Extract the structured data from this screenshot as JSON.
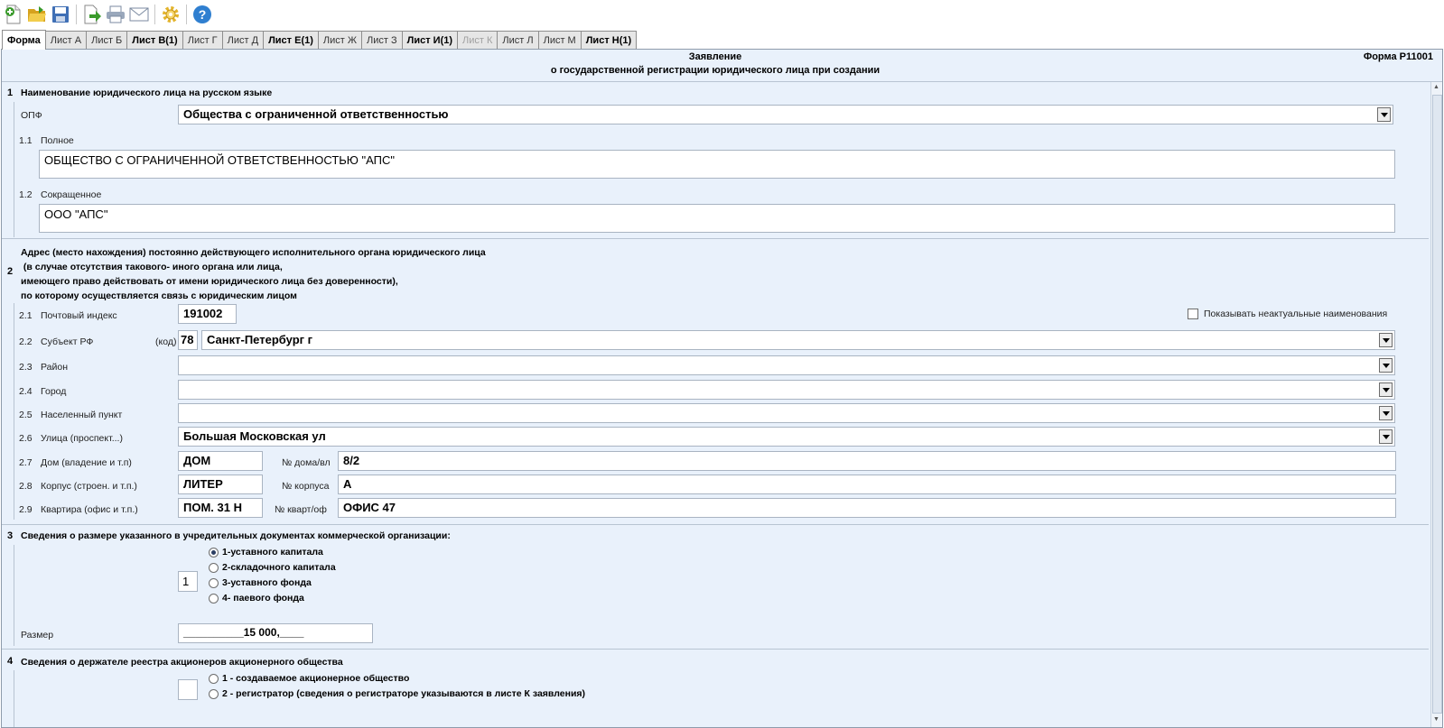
{
  "toolbar": {
    "buttons": [
      {
        "name": "new-document-icon",
        "color": "#3a9a2b"
      },
      {
        "name": "open-folder-icon",
        "color": "#e6b82d"
      },
      {
        "name": "save-disk-icon",
        "color": "#3f6fb5"
      },
      {
        "name": "export-icon",
        "color": "#4b87c7"
      },
      {
        "name": "print-icon",
        "color": "#7b8aa0"
      },
      {
        "name": "email-icon",
        "color": "#7b8aa0"
      },
      {
        "name": "settings-gear-icon",
        "color": "#e3b32a"
      },
      {
        "name": "help-icon",
        "color": "#2f7fd0"
      }
    ]
  },
  "tabs": [
    {
      "label": "Форма",
      "state": "active"
    },
    {
      "label": "Лист А",
      "state": "normal"
    },
    {
      "label": "Лист Б",
      "state": "normal"
    },
    {
      "label": "Лист В(1)",
      "state": "bold"
    },
    {
      "label": "Лист Г",
      "state": "normal"
    },
    {
      "label": "Лист Д",
      "state": "normal"
    },
    {
      "label": "Лист Е(1)",
      "state": "bold"
    },
    {
      "label": "Лист Ж",
      "state": "normal"
    },
    {
      "label": "Лист З",
      "state": "normal"
    },
    {
      "label": "Лист И(1)",
      "state": "bold"
    },
    {
      "label": "Лист К",
      "state": "disabled"
    },
    {
      "label": "Лист Л",
      "state": "normal"
    },
    {
      "label": "Лист М",
      "state": "normal"
    },
    {
      "label": "Лист Н(1)",
      "state": "bold"
    }
  ],
  "header": {
    "title_line1": "Заявление",
    "title_line2": "о государственной регистрации юридического лица при создании",
    "form_code": "Форма Р11001"
  },
  "section1": {
    "num": "1",
    "title": "Наименование юридического лица на русском языке",
    "opf_label": "ОПФ",
    "opf_value": "Общества с ограниченной ответственностью",
    "full_num": "1.1",
    "full_label": "Полное",
    "full_value": "ОБЩЕСТВО С ОГРАНИЧЕННОЙ ОТВЕТСТВЕННОСТЬЮ \"АПС\"",
    "short_num": "1.2",
    "short_label": "Сокращенное",
    "short_value": "ООО \"АПС\""
  },
  "section2": {
    "num": "2",
    "title_lines": [
      "Адрес (место нахождения) постоянно действующего исполнительного органа юридического лица",
      " (в случае отсутствия такового- иного органа или лица,",
      "имеющего право действовать от имени юридического лица без доверенности),",
      "по которому осуществляется связь с юридическим лицом"
    ],
    "show_obsolete_label": "Показывать неактуальные наименования",
    "show_obsolete_checked": false,
    "postal": {
      "num": "2.1",
      "label": "Почтовый индекс",
      "value": "191002"
    },
    "subject": {
      "num": "2.2",
      "label": "Субъект РФ",
      "code_label": "(код)",
      "code": "78",
      "value": "Санкт-Петербург г"
    },
    "district": {
      "num": "2.3",
      "label": "Район",
      "value": ""
    },
    "city": {
      "num": "2.4",
      "label": "Город",
      "value": ""
    },
    "locality": {
      "num": "2.5",
      "label": "Населенный пункт",
      "value": ""
    },
    "street": {
      "num": "2.6",
      "label": "Улица (проспект...)",
      "value": "Большая Московская ул"
    },
    "house": {
      "num": "2.7",
      "label": "Дом (владение и т.п)",
      "type": "ДОМ",
      "num_label": "№ дома/вл",
      "value": "8/2"
    },
    "building": {
      "num": "2.8",
      "label": "Корпус (строен. и т.п.)",
      "type": "ЛИТЕР",
      "num_label": "№ корпуса",
      "value": "А"
    },
    "apartment": {
      "num": "2.9",
      "label": "Квартира (офис и т.п.)",
      "type": "ПОМ. 31 Н",
      "num_label": "№ кварт/оф",
      "value": "ОФИС 47"
    }
  },
  "section3": {
    "num": "3",
    "title": "Сведения о размере указанного в учредительных документах коммерческой организации:",
    "selected_code": "1",
    "options": [
      {
        "label": "1-уставного капитала",
        "checked": true
      },
      {
        "label": "2-складочного капитала",
        "checked": false
      },
      {
        "label": "3-уставного фонда",
        "checked": false
      },
      {
        "label": "4- паевого фонда",
        "checked": false
      }
    ],
    "size_label": "Размер",
    "size_value": "__________15 000,____"
  },
  "section4": {
    "num": "4",
    "title": "Сведения о держателе реестра акционеров акционерного общества",
    "selected_code": "",
    "options": [
      {
        "label": "1 - создаваемое акционерное общество",
        "checked": false
      },
      {
        "label": "2 - регистратор (сведения о регистраторе указываются в листе К заявления)",
        "checked": false
      }
    ]
  }
}
